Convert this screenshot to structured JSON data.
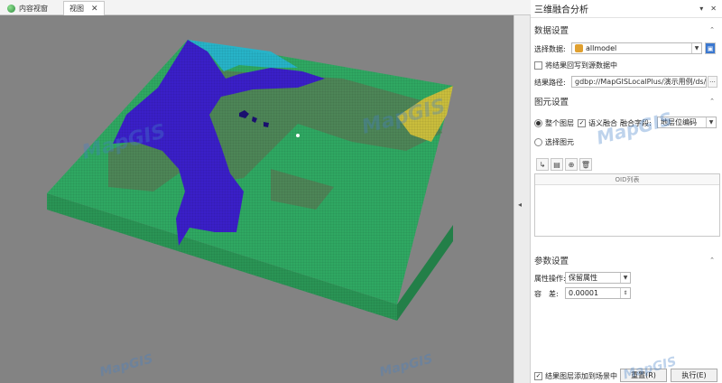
{
  "tabs": [
    {
      "label": "内容视窗"
    },
    {
      "label": "视图",
      "close": "✕"
    }
  ],
  "panel": {
    "title": "三维融合分析",
    "title_pin": "▾",
    "title_close": "✕",
    "data_section": {
      "header": "数据设置",
      "select_data_label": "选择数据:",
      "select_data_value": "allmodel",
      "write_back_label": "将结果回写到源数据中",
      "result_path_label": "结果路径:",
      "result_path_value": "gdbp://MapGISLocalPlus/演示用例/ds/数据融合",
      "browse": "···"
    },
    "element_section": {
      "header": "图元设置",
      "whole_layer_label": "整个图层",
      "semantic_fusion_label": "语义融合",
      "fusion_field_label": "融合字段:",
      "fusion_field_value": "地层位编码",
      "select_element_label": "选择图元",
      "oid_list_header": "OID列表"
    },
    "param_section": {
      "header": "参数设置",
      "attr_op_label": "属性操作:",
      "attr_op_value": "保留属性",
      "tolerance_label": "容　差:",
      "tolerance_value": "0.00001"
    },
    "add_to_scene_label": "结果图层添加到场景中",
    "reset_label": "重置(R)",
    "execute_label": "执行(E)"
  },
  "watermark_text": "MapGIS",
  "colors": {
    "viewport_bg": "#838383",
    "terrain_green": "#2fa862",
    "terrain_dark": "#4d8557",
    "terrain_blue": "#3a1fc8",
    "terrain_cyan": "#27b3c8",
    "terrain_yellow": "#c9bd3c"
  }
}
